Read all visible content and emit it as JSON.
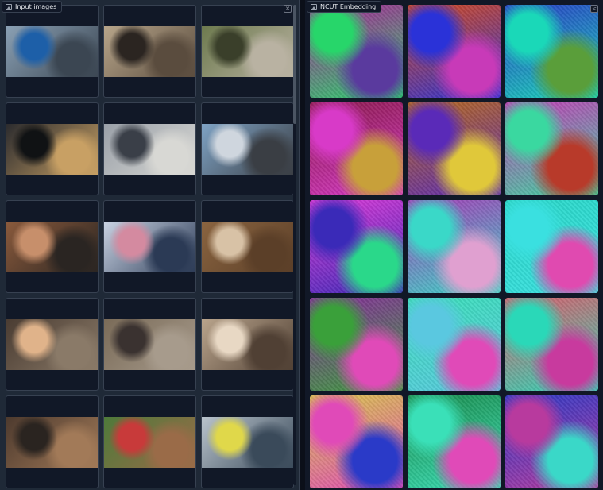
{
  "left_panel": {
    "title": "Input images",
    "close_icon": "close-icon",
    "label_icon": "image-icon",
    "images": [
      {
        "desc": "hand-wiping-sink",
        "c1": "#8aa0b4",
        "c2": "#3b4652",
        "c3": "#1d5fa8"
      },
      {
        "desc": "hands-on-counter",
        "c1": "#b7a58a",
        "c2": "#5a4c3e",
        "c3": "#2b2521"
      },
      {
        "desc": "stone-steps-outdoors",
        "c1": "#6d7a4e",
        "c2": "#b9b2a2",
        "c3": "#3a3f2a"
      },
      {
        "desc": "oven-interior",
        "c1": "#2b2b2e",
        "c2": "#c8a064",
        "c3": "#101214"
      },
      {
        "desc": "room-with-tool",
        "c1": "#9aa0a8",
        "c2": "#d8d8d4",
        "c3": "#3a3f48"
      },
      {
        "desc": "car-interior-driving",
        "c1": "#7fa3c5",
        "c2": "#3a3e44",
        "c3": "#cfd6de"
      },
      {
        "desc": "bicycle-repair",
        "c1": "#8a5a3c",
        "c2": "#2a2522",
        "c3": "#c78f6b"
      },
      {
        "desc": "crafting-on-table",
        "c1": "#c9d3e3",
        "c2": "#2b3a55",
        "c3": "#d48aa0"
      },
      {
        "desc": "digging-soil",
        "c1": "#8a6440",
        "c2": "#5b3f28",
        "c3": "#d8c2a6"
      },
      {
        "desc": "mechanical-parts",
        "c1": "#4a3c32",
        "c2": "#8a7a68",
        "c3": "#e0b38a"
      },
      {
        "desc": "walking-on-ground",
        "c1": "#7a6b58",
        "c2": "#a79b8c",
        "c3": "#3a3230"
      },
      {
        "desc": "living-room-floor",
        "c1": "#b9a48c",
        "c2": "#504034",
        "c3": "#e8d8c4"
      },
      {
        "desc": "wood-workbench",
        "c1": "#4d3a2e",
        "c2": "#a27a58",
        "c3": "#2a2420"
      },
      {
        "desc": "gardening-plants",
        "c1": "#4e7a3a",
        "c2": "#9a6b48",
        "c3": "#c83a3a"
      },
      {
        "desc": "washing-car",
        "c1": "#b9c3cc",
        "c2": "#3a4a5a",
        "c3": "#e0d84a"
      }
    ]
  },
  "right_panel": {
    "title": "NCUT Embedding",
    "share_icon": "share-icon",
    "label_icon": "image-icon",
    "embeddings": [
      {
        "c1": "#b01c9a",
        "c2": "#27d66a",
        "c3": "#5a3a9e"
      },
      {
        "c1": "#d84a1a",
        "c2": "#2a32d8",
        "c3": "#c83ab8"
      },
      {
        "c1": "#2a3ac8",
        "c2": "#1ad8b8",
        "c3": "#5a9e3a"
      },
      {
        "c1": "#8a1a4a",
        "c2": "#d83ac8",
        "c3": "#c8a03a"
      },
      {
        "c1": "#b86a1a",
        "c2": "#5a2ab8",
        "c3": "#e0c83a"
      },
      {
        "c1": "#c83ab8",
        "c2": "#3ad8a0",
        "c3": "#b83a2a"
      },
      {
        "c1": "#e03ad8",
        "c2": "#3a2ab8",
        "c3": "#2ad88a"
      },
      {
        "c1": "#a83ab8",
        "c2": "#3ad8c8",
        "c3": "#e0a0d0"
      },
      {
        "c1": "#2ad8c8",
        "c2": "#3ae0e0",
        "c3": "#e04ab0"
      },
      {
        "c1": "#8a2a9e",
        "c2": "#3aa03a",
        "c3": "#e04ab8"
      },
      {
        "c1": "#3ae0b8",
        "c2": "#5ac8e0",
        "c3": "#e04ab8"
      },
      {
        "c1": "#e05a6a",
        "c2": "#2ad8b8",
        "c3": "#c83a9e"
      },
      {
        "c1": "#d8c84a",
        "c2": "#e04ab8",
        "c3": "#2a3ac8"
      },
      {
        "c1": "#1a8a4a",
        "c2": "#3ae0b8",
        "c3": "#e04ab8"
      },
      {
        "c1": "#2a3ac8",
        "c2": "#b83a9e",
        "c3": "#3ad8c8"
      }
    ]
  }
}
